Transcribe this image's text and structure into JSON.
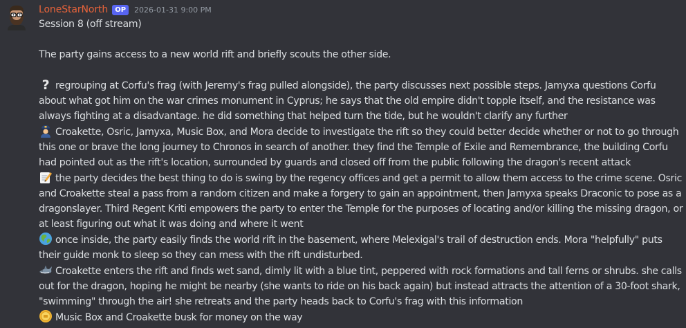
{
  "message": {
    "author": "LoneStarNorth",
    "op_badge": "OP",
    "timestamp": "2026-01-31 9:00 PM",
    "avatar_icon": "bearded-man-with-glasses-avatar",
    "title_line": "Session 8 (off stream)",
    "intro": "The party gains access to a new world rift and briefly scouts the other side.",
    "entries": [
      {
        "icon": "question-mark-icon",
        "text": "regrouping at Corfu's frag (with Jeremy's frag pulled alongside), the party discusses next possible steps. Jamyxa questions Corfu about what got him on the war crimes monument in Cyprus; he says that the old empire didn't topple itself, and the resistance was always fighting at a disadvantage. he did something that helped turn the tide, but he wouldn't clarify any further"
      },
      {
        "icon": "guard-icon",
        "text": "Croakette, Osric, Jamyxa, Music Box, and Mora decide to investigate the rift so they could better decide whether or not to go through this one or brave the long journey to Chronos in search of another. they find the Temple of Exile and Remembrance, the building Corfu had pointed out as the rift's location, surrounded by guards and closed off from the public following the dragon's recent attack"
      },
      {
        "icon": "memo-icon",
        "text": "the party decides the best thing to do is swing by the regency offices and get a permit to allow them access to the crime scene. Osric and Croakette steal a pass from a random citizen and make a forgery to gain an appointment, then Jamyxa speaks Draconic to pose as a dragonslayer. Third Regent Kriti empowers the party to enter the Temple for the purposes of locating and/or killing the missing dragon, or at least figuring out what it was doing and where it went"
      },
      {
        "icon": "globe-icon",
        "text": "once inside, the party easily finds the world rift in the basement, where Melexigal's trail of destruction ends. Mora \"helpfully\" puts their guide monk to sleep so they can mess with the rift undisturbed."
      },
      {
        "icon": "shark-icon",
        "text": "Croakette enters the rift and finds wet sand, dimly lit with a blue tint, peppered with rock formations and tall ferns or shrubs. she calls out for the dragon, hoping he might be nearby (she wants to ride on his back again) but instead attracts the attention of a 30-foot shark, \"swimming\" through the air! she retreats and the party heads back to Corfu's frag with this information"
      },
      {
        "icon": "coin-icon",
        "text": "Music Box and Croakette busk for money on the way"
      }
    ]
  }
}
